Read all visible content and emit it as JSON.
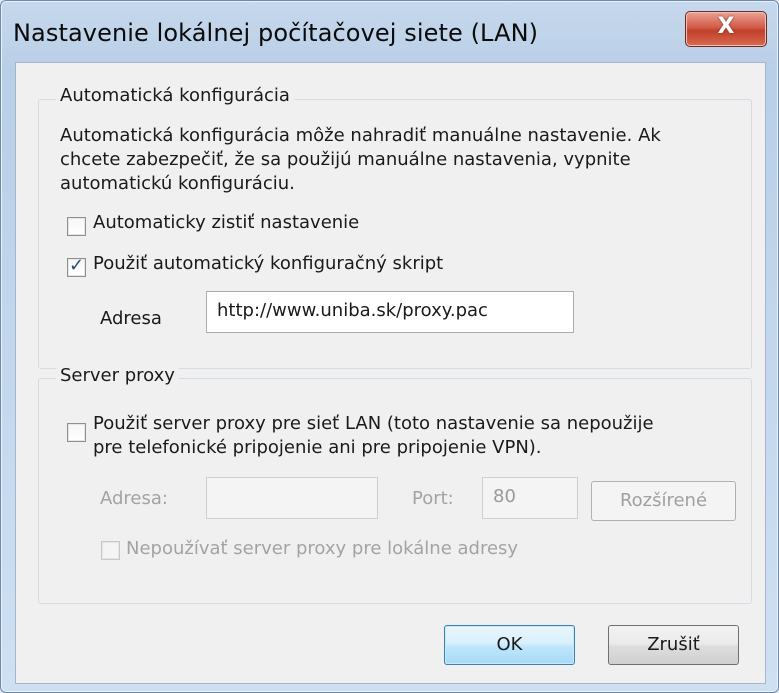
{
  "window": {
    "title": "Nastavenie lokálnej počítačovej siete (LAN)",
    "close_label": "X"
  },
  "auto_config": {
    "group_label": "Automatická konfigurácia",
    "description_line1": "Automatická konfigurácia môže nahradiť manuálne nastavenie. Ak",
    "description_line2": "chcete zabezpečiť, že sa použijú manuálne nastavenia, vypnite",
    "description_line3": "automatickú konfiguráciu.",
    "auto_detect": {
      "label": "Automaticky zistiť nastavenie",
      "checked": false
    },
    "use_script": {
      "label": "Použiť automatický konfiguračný skript",
      "checked": true
    },
    "address_label": "Adresa",
    "address_value": "http://www.uniba.sk/proxy.pac"
  },
  "proxy": {
    "group_label": "Server proxy",
    "use_proxy_line1": "Použiť server proxy pre sieť LAN (toto nastavenie sa nepoužije",
    "use_proxy_line2": "pre telefonické pripojenie ani pre pripojenie VPN).",
    "use_proxy_checked": false,
    "address_label": "Adresa:",
    "address_value": "",
    "port_label": "Port:",
    "port_value": "80",
    "advanced_label": "Rozšírené",
    "bypass_label": "Nepoužívať server proxy pre lokálne adresy",
    "bypass_checked": false
  },
  "footer": {
    "ok_label": "OK",
    "cancel_label": "Zrušiť"
  }
}
